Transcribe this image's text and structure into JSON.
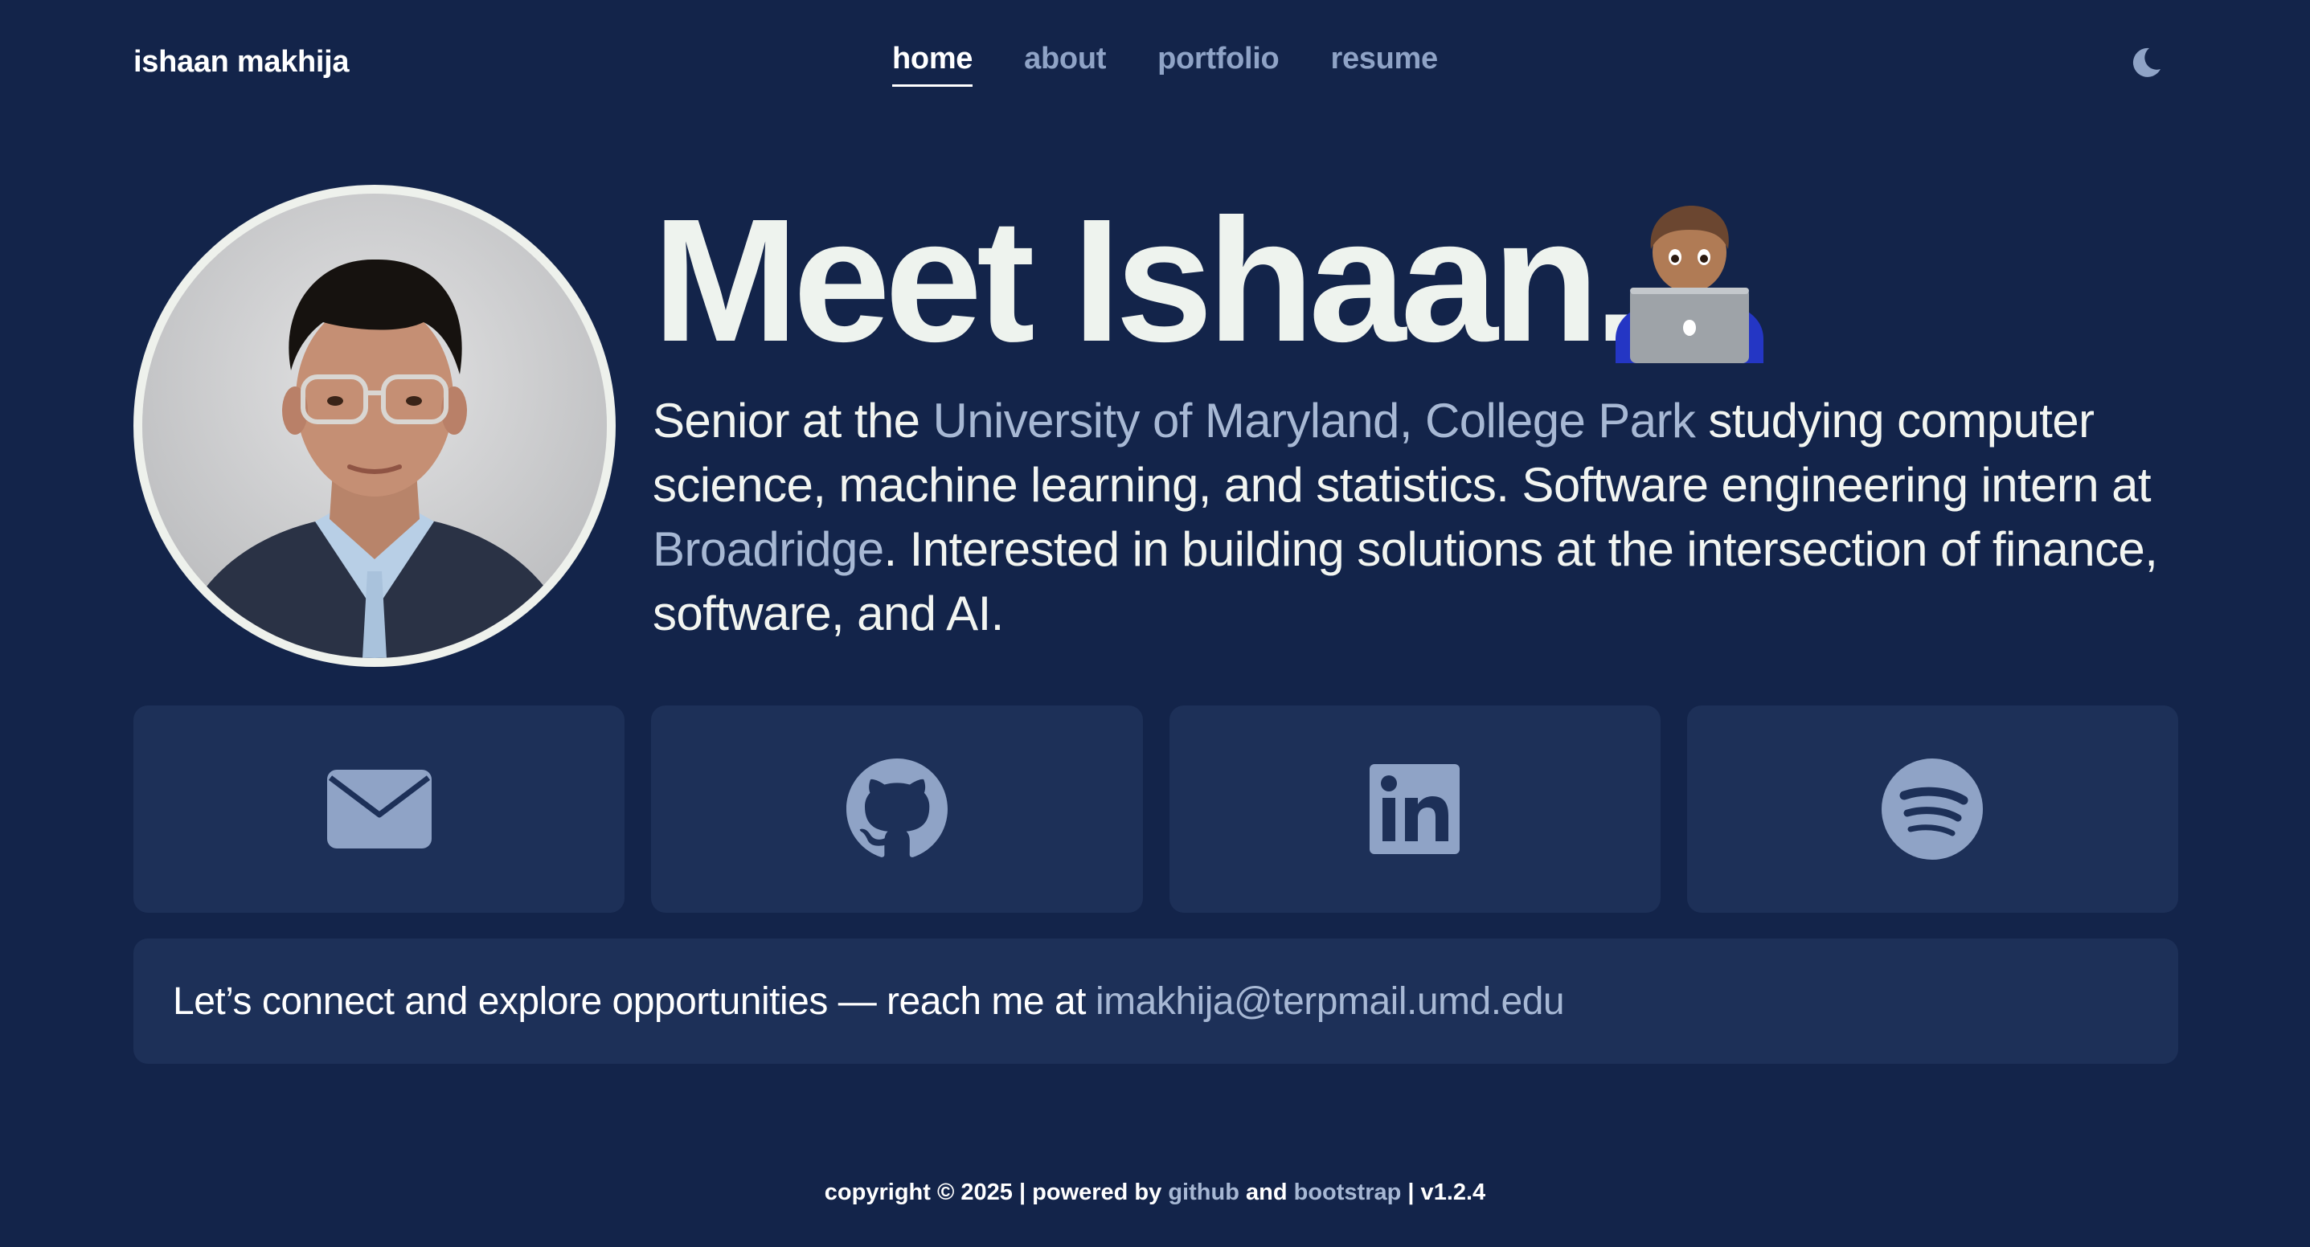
{
  "brand": "ishaan makhija",
  "nav": {
    "items": [
      "home",
      "about",
      "portfolio",
      "resume"
    ],
    "active": "home",
    "theme_toggle_icon": "moon-icon"
  },
  "hero": {
    "title": "Meet Ishaan.",
    "emoji_icon": "man-technologist-emoji",
    "bio": {
      "part1": "Senior at the ",
      "university": "University of Maryland, College Park",
      "part2": " studying computer science, machine learning, and statistics. Software engineering intern at ",
      "company": "Broadridge",
      "part3": ". Interested in building solutions at the intersection of finance, software, and AI."
    }
  },
  "social": [
    {
      "icon": "envelope-icon",
      "label": "email"
    },
    {
      "icon": "github-icon",
      "label": "github"
    },
    {
      "icon": "linkedin-icon",
      "label": "linkedin"
    },
    {
      "icon": "spotify-icon",
      "label": "spotify"
    }
  ],
  "connect": {
    "text": "Let’s connect and explore opportunities — reach me at",
    "email": "imakhija@terpmail.umd.edu"
  },
  "footer": {
    "copyright": "copyright © 2025 | powered by",
    "link1": "github",
    "and": "and",
    "link2": "bootstrap",
    "version": "| v1.2.4"
  },
  "colors": {
    "background": "#13244a",
    "card": "#1d3058",
    "accent": "#a7b8d4",
    "icon": "#8fa3c6"
  }
}
